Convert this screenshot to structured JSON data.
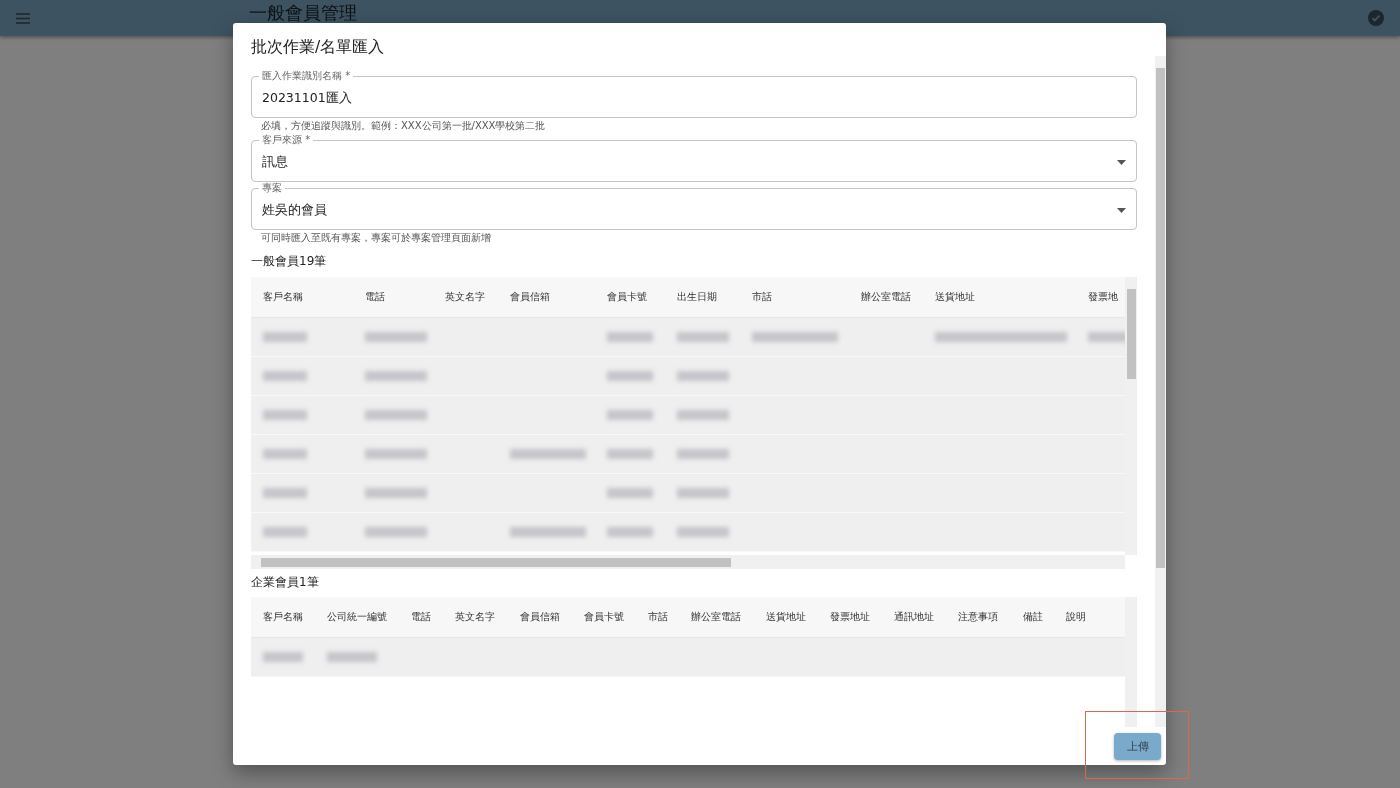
{
  "app_bar": {
    "title": "一般會員管理"
  },
  "dialog": {
    "title": "批次作業/名單匯入",
    "fields": [
      {
        "kind": "text",
        "label": "匯入作業識別名稱 *",
        "value": "20231101匯入",
        "helper": "必填，方便追蹤與識別。範例：XXX公司第一批/XXX學校第二批"
      },
      {
        "kind": "select",
        "label": "客戶來源 *",
        "value": "訊息"
      },
      {
        "kind": "select",
        "label": "專案",
        "value": "姓吳的會員",
        "helper": "可同時匯入至既有專案，專案可於專案管理頁面新增"
      }
    ],
    "tables": [
      {
        "title": "一般會員19筆",
        "columns": [
          "客戶名稱",
          "電話",
          "英文名字",
          "會員信箱",
          "會員卡號",
          "出生日期",
          "市話",
          "辦公室電話",
          "送貨地址",
          "發票地"
        ],
        "rows": [
          {
            "cells": [
              {
                "kind": "blurred"
              },
              {
                "kind": "blurred"
              },
              {
                "kind": "empty"
              },
              {
                "kind": "empty"
              },
              {
                "kind": "blurred"
              },
              {
                "kind": "blurred"
              },
              {
                "kind": "blurred"
              },
              {
                "kind": "empty"
              },
              {
                "kind": "blurred"
              },
              {
                "kind": "blurred"
              }
            ]
          },
          {
            "cells": [
              {
                "kind": "blurred"
              },
              {
                "kind": "blurred"
              },
              {
                "kind": "empty"
              },
              {
                "kind": "empty"
              },
              {
                "kind": "blurred"
              },
              {
                "kind": "blurred"
              }
            ]
          },
          {
            "cells": [
              {
                "kind": "blurred"
              },
              {
                "kind": "blurred"
              },
              {
                "kind": "empty"
              },
              {
                "kind": "empty"
              },
              {
                "kind": "blurred"
              },
              {
                "kind": "blurred"
              }
            ]
          },
          {
            "cells": [
              {
                "kind": "blurred"
              },
              {
                "kind": "blurred"
              },
              {
                "kind": "empty"
              },
              {
                "kind": "blurred"
              },
              {
                "kind": "blurred"
              },
              {
                "kind": "blurred"
              }
            ]
          },
          {
            "cells": [
              {
                "kind": "blurred"
              },
              {
                "kind": "blurred"
              },
              {
                "kind": "empty"
              },
              {
                "kind": "empty"
              },
              {
                "kind": "blurred"
              },
              {
                "kind": "blurred"
              }
            ]
          },
          {
            "cells": [
              {
                "kind": "blurred"
              },
              {
                "kind": "blurred"
              },
              {
                "kind": "empty"
              },
              {
                "kind": "blurred"
              },
              {
                "kind": "blurred"
              },
              {
                "kind": "blurred"
              }
            ]
          }
        ]
      },
      {
        "title": "企業會員1筆",
        "columns": [
          "客戶名稱",
          "公司統一編號",
          "電話",
          "英文名字",
          "會員信箱",
          "會員卡號",
          "市話",
          "辦公室電話",
          "送貨地址",
          "發票地址",
          "通訊地址",
          "注意事項",
          "備註",
          "說明"
        ],
        "rows": [
          {
            "cells": [
              {
                "kind": "blurred"
              },
              {
                "kind": "blurred"
              }
            ]
          }
        ]
      }
    ],
    "upload_button": {
      "label": "上傳",
      "highlighted": true
    }
  }
}
